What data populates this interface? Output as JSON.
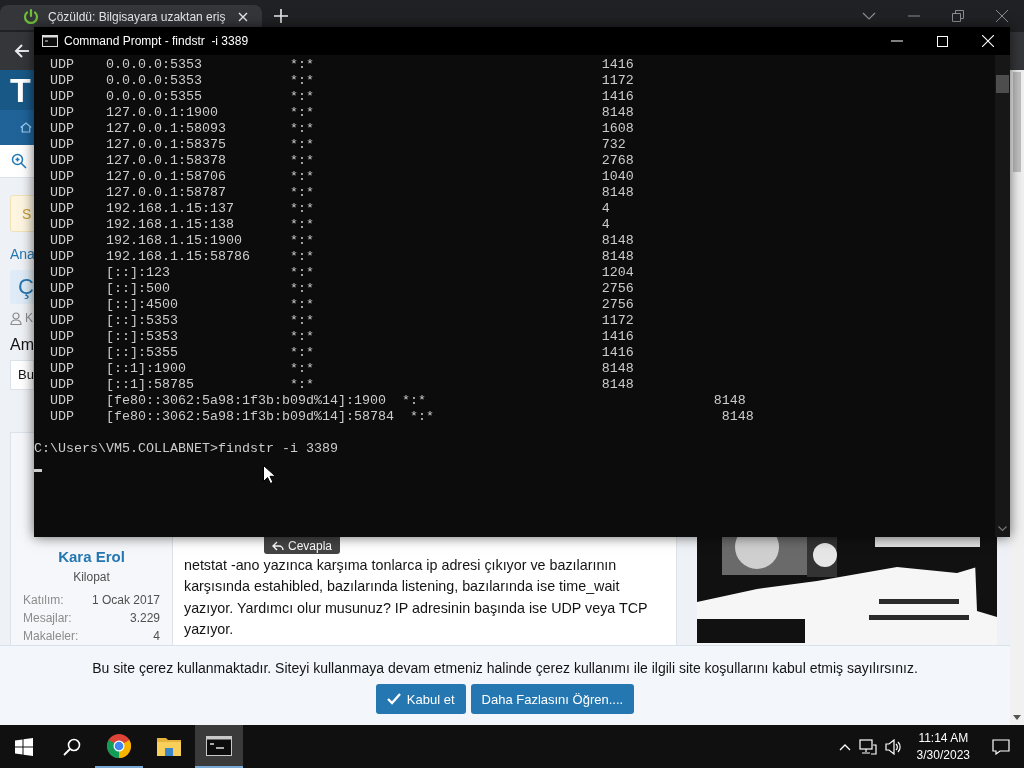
{
  "browser": {
    "tab_title": "Çözüldü: Bilgisayara uzaktan eriş"
  },
  "page": {
    "logo_letter": "T",
    "notice_fragment": "S",
    "breadcrumb_fragment": "Ana",
    "prefix_fragment": "Ç",
    "author_fragment": "K",
    "heading_fragment": "Am",
    "field_fragment": "Bu"
  },
  "post": {
    "author": "Kara Erol",
    "role": "Kilopat",
    "stats": [
      {
        "label": "Katılım:",
        "value": "1 Ocak 2017"
      },
      {
        "label": "Mesajlar:",
        "value": "3.229"
      },
      {
        "label": "Makaleler:",
        "value": "4"
      }
    ],
    "message": "netstat -ano yazınca karşıma tonlarca ip adresi çıkıyor ve bazılarının karşısında estahibled, bazılarında listening, bazılarında ise time_wait yazıyor. Yardımcı olur musunuz? IP adresinin başında ise UDP veya TCP yazıyor.",
    "tooltip": "Cevapla"
  },
  "cookie_banner": {
    "message": "Bu site çerez kullanmaktadır. Siteyi kullanmaya devam etmeniz halinde çerez kullanımı ile ilgili site koşullarını kabul etmiş sayılırsınız.",
    "buttons": [
      {
        "label": "Kabul et",
        "kind": "accept"
      },
      {
        "label": "Daha Fazlasını Öğren....",
        "kind": "more"
      }
    ]
  },
  "console": {
    "title": "Command Prompt - findstr  -i 3389",
    "rows": [
      {
        "proto": "UDP",
        "local": "0.0.0.0:5353",
        "foreign": "*:*",
        "pid": "1416"
      },
      {
        "proto": "UDP",
        "local": "0.0.0.0:5353",
        "foreign": "*:*",
        "pid": "1172"
      },
      {
        "proto": "UDP",
        "local": "0.0.0.0:5355",
        "foreign": "*:*",
        "pid": "1416"
      },
      {
        "proto": "UDP",
        "local": "127.0.0.1:1900",
        "foreign": "*:*",
        "pid": "8148"
      },
      {
        "proto": "UDP",
        "local": "127.0.0.1:58093",
        "foreign": "*:*",
        "pid": "1608"
      },
      {
        "proto": "UDP",
        "local": "127.0.0.1:58375",
        "foreign": "*:*",
        "pid": "732"
      },
      {
        "proto": "UDP",
        "local": "127.0.0.1:58378",
        "foreign": "*:*",
        "pid": "2768"
      },
      {
        "proto": "UDP",
        "local": "127.0.0.1:58706",
        "foreign": "*:*",
        "pid": "1040"
      },
      {
        "proto": "UDP",
        "local": "127.0.0.1:58787",
        "foreign": "*:*",
        "pid": "8148"
      },
      {
        "proto": "UDP",
        "local": "192.168.1.15:137",
        "foreign": "*:*",
        "pid": "4"
      },
      {
        "proto": "UDP",
        "local": "192.168.1.15:138",
        "foreign": "*:*",
        "pid": "4"
      },
      {
        "proto": "UDP",
        "local": "192.168.1.15:1900",
        "foreign": "*:*",
        "pid": "8148"
      },
      {
        "proto": "UDP",
        "local": "192.168.1.15:58786",
        "foreign": "*:*",
        "pid": "8148"
      },
      {
        "proto": "UDP",
        "local": "[::]:123",
        "foreign": "*:*",
        "pid": "1204"
      },
      {
        "proto": "UDP",
        "local": "[::]:500",
        "foreign": "*:*",
        "pid": "2756"
      },
      {
        "proto": "UDP",
        "local": "[::]:4500",
        "foreign": "*:*",
        "pid": "2756"
      },
      {
        "proto": "UDP",
        "local": "[::]:5353",
        "foreign": "*:*",
        "pid": "1172"
      },
      {
        "proto": "UDP",
        "local": "[::]:5353",
        "foreign": "*:*",
        "pid": "1416"
      },
      {
        "proto": "UDP",
        "local": "[::]:5355",
        "foreign": "*:*",
        "pid": "1416"
      },
      {
        "proto": "UDP",
        "local": "[::1]:1900",
        "foreign": "*:*",
        "pid": "8148"
      },
      {
        "proto": "UDP",
        "local": "[::1]:58785",
        "foreign": "*:*",
        "pid": "8148"
      },
      {
        "proto": "UDP",
        "local": "[fe80::3062:5a98:1f3b:b09d%14]:1900",
        "foreign": "*:*",
        "pid": "8148"
      },
      {
        "proto": "UDP",
        "local": "[fe80::3062:5a98:1f3b:b09d%14]:58784",
        "foreign": "*:*",
        "pid": "8148"
      }
    ],
    "prompt": "C:\\Users\\VM5.COLLABNET>findstr -i 3389"
  },
  "taskbar": {
    "apps": [
      {
        "kind": "browser",
        "running": true,
        "selected": false
      },
      {
        "kind": "folder",
        "running": false,
        "selected": false
      },
      {
        "kind": "terminal",
        "running": true,
        "selected": true
      }
    ],
    "time": "11:14 AM",
    "date": "3/30/2023"
  }
}
